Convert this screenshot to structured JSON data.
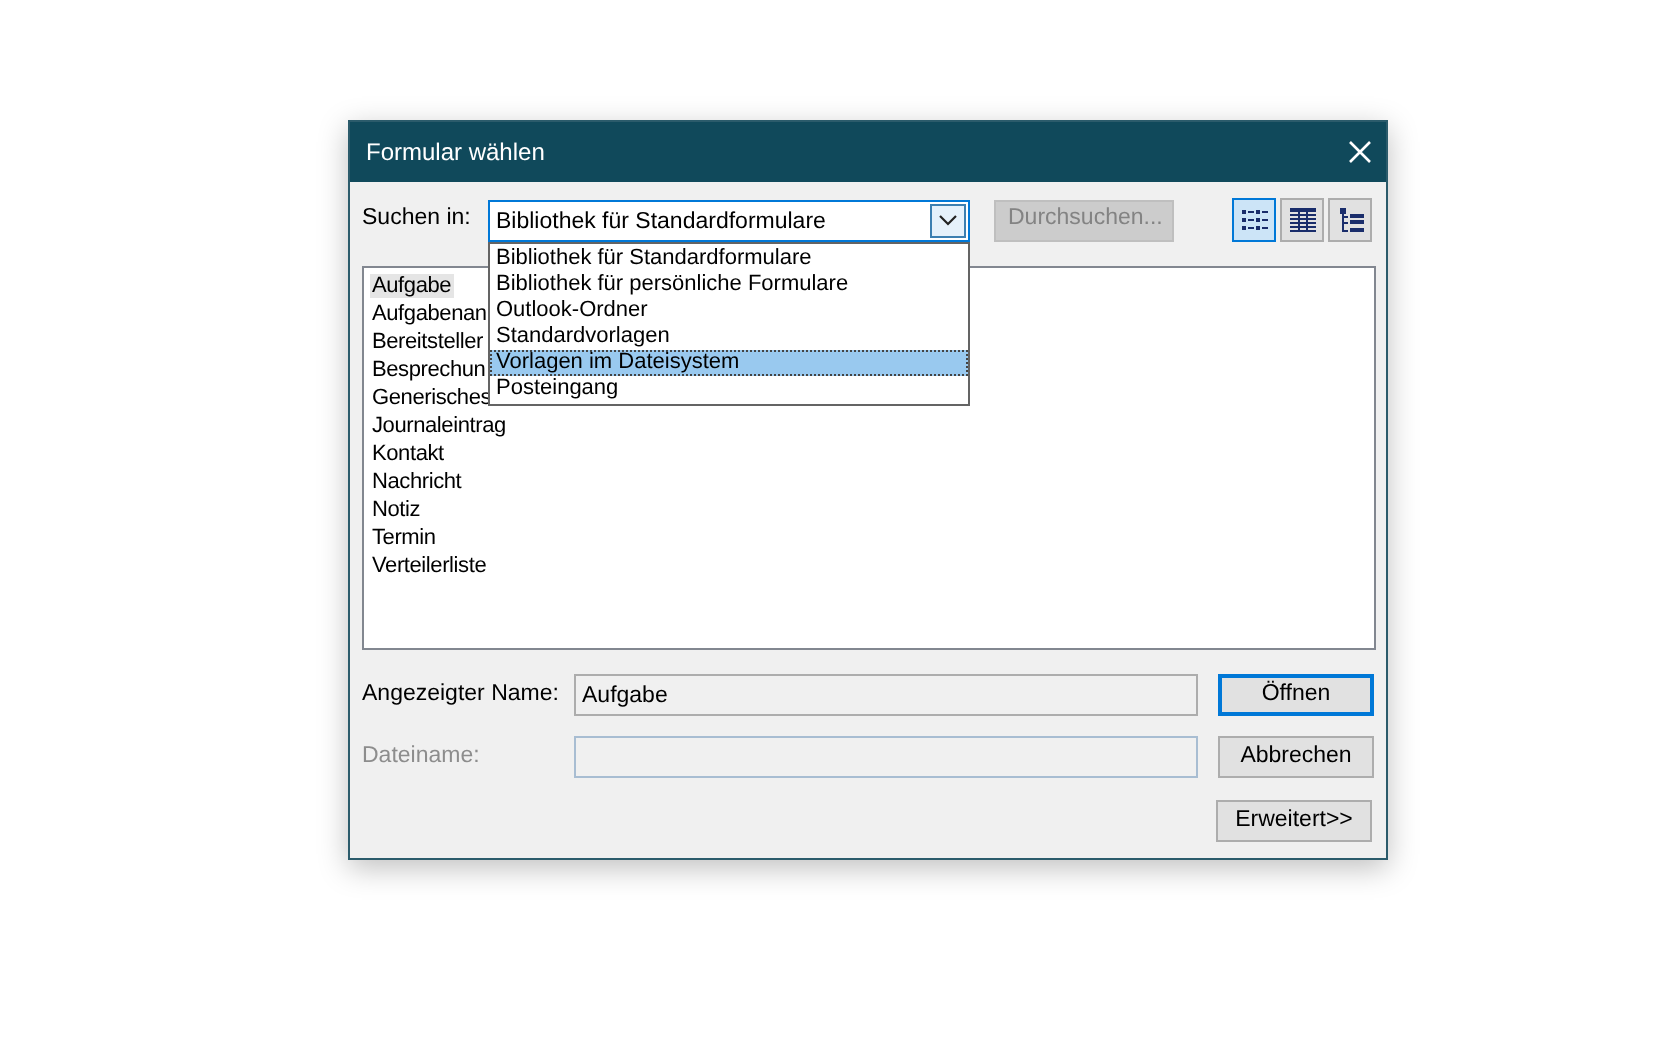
{
  "window": {
    "title": "Formular wählen"
  },
  "search_in": {
    "label": "Suchen in:",
    "value": "Bibliothek für Standardformulare",
    "expanded": true,
    "options": [
      {
        "label": "Bibliothek für Standardformulare",
        "highlighted": false
      },
      {
        "label": "Bibliothek für persönliche Formulare",
        "highlighted": false
      },
      {
        "label": "Outlook-Ordner",
        "highlighted": false
      },
      {
        "label": "Standardvorlagen",
        "highlighted": false
      },
      {
        "label": "Vorlagen im Dateisystem",
        "highlighted": true
      },
      {
        "label": "Posteingang",
        "highlighted": false
      }
    ]
  },
  "browse_button": {
    "label": "Durchsuchen...",
    "disabled": true
  },
  "view_buttons": [
    {
      "kind": "list",
      "selected": true
    },
    {
      "kind": "details",
      "selected": false
    },
    {
      "kind": "tree",
      "selected": false
    }
  ],
  "forms": [
    {
      "label": "Aufgabe",
      "selected": true
    },
    {
      "label": "Aufgabenan",
      "selected": false
    },
    {
      "label": "Bereitsteller",
      "selected": false
    },
    {
      "label": "Besprechun",
      "selected": false
    },
    {
      "label": "Generisches",
      "selected": false
    },
    {
      "label": "Journaleintrag",
      "selected": false
    },
    {
      "label": "Kontakt",
      "selected": false
    },
    {
      "label": "Nachricht",
      "selected": false
    },
    {
      "label": "Notiz",
      "selected": false
    },
    {
      "label": "Termin",
      "selected": false
    },
    {
      "label": "Verteilerliste",
      "selected": false
    }
  ],
  "display_name": {
    "label": "Angezeigter Name:",
    "value": "Aufgabe",
    "disabled": false
  },
  "file_name": {
    "label": "Dateiname:",
    "disabled": true
  },
  "buttons": [
    {
      "label": "Öffnen",
      "default": true
    },
    {
      "label": "Abbrechen",
      "default": false
    },
    {
      "label": "Erweitert>>",
      "default": false
    }
  ]
}
